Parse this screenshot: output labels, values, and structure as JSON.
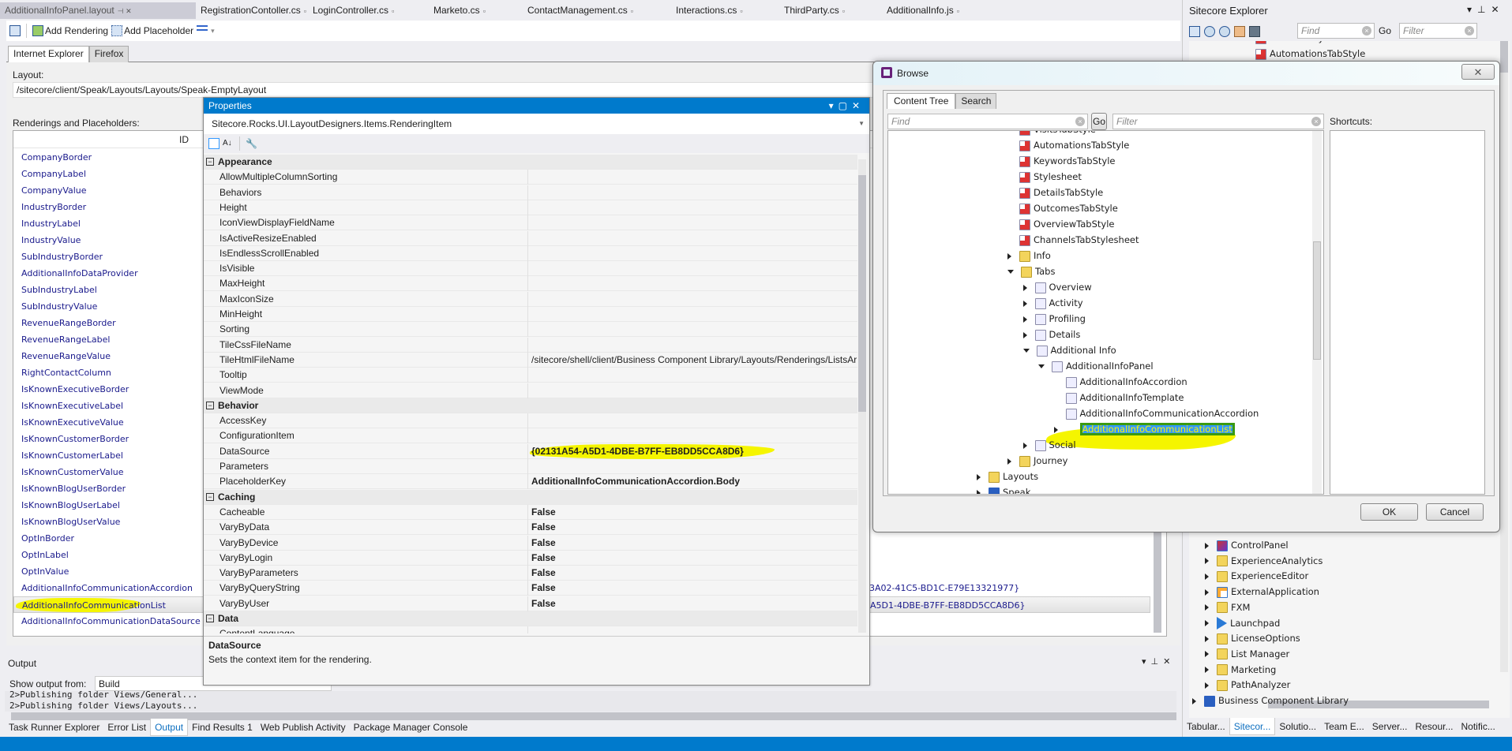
{
  "doc_tabs": [
    "AdditionalInfoPanel.layout",
    "RegistrationContoller.cs",
    "LoginController.cs",
    "Marketo.cs",
    "ContactManagement.cs",
    "Interactions.cs",
    "ThirdParty.cs",
    "AdditionalInfo.js"
  ],
  "toolbar": {
    "add_rendering": "Add Rendering",
    "add_placeholder": "Add Placeholder"
  },
  "browser_tabs": [
    "Internet Explorer",
    "Firefox"
  ],
  "layout": {
    "label": "Layout:",
    "value": "/sitecore/client/Speak/Layouts/Layouts/Speak-EmptyLayout"
  },
  "renderings": {
    "label": "Renderings and Placeholders:",
    "id_header": "ID",
    "items": [
      "CompanyBorder",
      "CompanyLabel",
      "CompanyValue",
      "IndustryBorder",
      "IndustryLabel",
      "IndustryValue",
      "SubIndustryBorder",
      "AdditionalInfoDataProvider",
      "SubIndustryLabel",
      "SubIndustryValue",
      "RevenueRangeBorder",
      "RevenueRangeLabel",
      "RevenueRangeValue",
      "RightContactColumn",
      "IsKnownExecutiveBorder",
      "IsKnownExecutiveLabel",
      "IsKnownExecutiveValue",
      "IsKnownCustomerBorder",
      "IsKnownCustomerLabel",
      "IsKnownCustomerValue",
      "IsKnownBlogUserBorder",
      "IsKnownBlogUserLabel",
      "IsKnownBlogUserValue",
      "OptInBorder",
      "OptInLabel",
      "OptInValue",
      "AdditionalInfoCommunicationAccordion",
      "AdditionalInfoCommunicationList",
      "AdditionalInfoCommunicationDataSource"
    ],
    "selected": "AdditionalInfoCommunicationList",
    "visible_ids": {
      "AdditionalInfoCommunicationAccordion": "3A02-41C5-BD1C-E79E13321977}",
      "AdditionalInfoCommunicationList": "A5D1-4DBE-B7FF-EB8DD5CCA8D6}"
    }
  },
  "properties": {
    "title": "Properties",
    "object": "Sitecore.Rocks.UI.LayoutDesigners.Items.RenderingItem",
    "categories": [
      {
        "name": "Appearance",
        "items": [
          {
            "name": "AllowMultipleColumnSorting",
            "value": ""
          },
          {
            "name": "Behaviors",
            "value": ""
          },
          {
            "name": "Height",
            "value": ""
          },
          {
            "name": "IconViewDisplayFieldName",
            "value": ""
          },
          {
            "name": "IsActiveResizeEnabled",
            "value": ""
          },
          {
            "name": "IsEndlessScrollEnabled",
            "value": ""
          },
          {
            "name": "IsVisible",
            "value": ""
          },
          {
            "name": "MaxHeight",
            "value": ""
          },
          {
            "name": "MaxIconSize",
            "value": ""
          },
          {
            "name": "MinHeight",
            "value": ""
          },
          {
            "name": "Sorting",
            "value": ""
          },
          {
            "name": "TileCssFileName",
            "value": ""
          },
          {
            "name": "TileHtmlFileName",
            "value": "/sitecore/shell/client/Business Component Library/Layouts/Renderings/ListsAr",
            "modified": false
          },
          {
            "name": "Tooltip",
            "value": ""
          },
          {
            "name": "ViewMode",
            "value": ""
          }
        ]
      },
      {
        "name": "Behavior",
        "items": [
          {
            "name": "AccessKey",
            "value": ""
          },
          {
            "name": "ConfigurationItem",
            "value": ""
          },
          {
            "name": "DataSource",
            "value": "{02131A54-A5D1-4DBE-B7FF-EB8DD5CCA8D6}",
            "modified": true,
            "highlight": true
          },
          {
            "name": "Parameters",
            "value": ""
          },
          {
            "name": "PlaceholderKey",
            "value": "AdditionalInfoCommunicationAccordion.Body",
            "modified": true
          }
        ]
      },
      {
        "name": "Caching",
        "items": [
          {
            "name": "Cacheable",
            "value": "False",
            "modified": true
          },
          {
            "name": "VaryByData",
            "value": "False",
            "modified": true
          },
          {
            "name": "VaryByDevice",
            "value": "False",
            "modified": true
          },
          {
            "name": "VaryByLogin",
            "value": "False",
            "modified": true
          },
          {
            "name": "VaryByParameters",
            "value": "False",
            "modified": true
          },
          {
            "name": "VaryByQueryString",
            "value": "False",
            "modified": true
          },
          {
            "name": "VaryByUser",
            "value": "False",
            "modified": true
          }
        ]
      },
      {
        "name": "Data",
        "items": [
          {
            "name": "ContentLanguage",
            "value": ""
          }
        ]
      }
    ],
    "description_title": "DataSource",
    "description_text": "Sets the context item for the rendering."
  },
  "output": {
    "title": "Output",
    "show_from_label": "Show output from:",
    "show_from_value": "Build",
    "lines": [
      "2>Publishing folder Views/General...",
      "2>Publishing folder Views/Layouts..."
    ]
  },
  "bottom_tabs": [
    "Task Runner Explorer",
    "Error List",
    "Output",
    "Find Results 1",
    "Web Publish Activity",
    "Package Manager Console"
  ],
  "bottom_tab_active": "Output",
  "explorer": {
    "title": "Sitecore Explorer",
    "find_placeholder": "Find",
    "go": "Go",
    "filter_placeholder": "Filter",
    "top_items": [
      "VisitsTabStyle",
      "AutomationsTabStyle",
      "KeywordsTabStyle"
    ],
    "items": [
      {
        "label": "ControlPanel",
        "icon": "cp"
      },
      {
        "label": "ExperienceAnalytics",
        "icon": "folder"
      },
      {
        "label": "ExperienceEditor",
        "icon": "folder"
      },
      {
        "label": "ExternalApplication",
        "icon": "app"
      },
      {
        "label": "FXM",
        "icon": "folder"
      },
      {
        "label": "Launchpad",
        "icon": "launch"
      },
      {
        "label": "LicenseOptions",
        "icon": "folder"
      },
      {
        "label": "List Manager",
        "icon": "folder"
      },
      {
        "label": "Marketing",
        "icon": "folder"
      },
      {
        "label": "PathAnalyzer",
        "icon": "folder"
      },
      {
        "label": "Business Component Library",
        "icon": "lib"
      }
    ],
    "tabs": [
      "Tabular...",
      "Sitecor...",
      "Solutio...",
      "Team E...",
      "Server...",
      "Resour...",
      "Notific..."
    ],
    "tab_active": "Sitecor..."
  },
  "browse": {
    "title": "Browse",
    "tabs": [
      "Content Tree",
      "Search"
    ],
    "find_placeholder": "Find",
    "go": "Go",
    "filter_placeholder": "Filter",
    "shortcuts_label": "Shortcuts:",
    "ok": "OK",
    "cancel": "Cancel",
    "tree": [
      {
        "label": "VisitsTabStyle",
        "level": 2,
        "icon": "docx",
        "state": "none"
      },
      {
        "label": "AutomationsTabStyle",
        "level": 2,
        "icon": "docx",
        "state": "none"
      },
      {
        "label": "KeywordsTabStyle",
        "level": 2,
        "icon": "docx",
        "state": "none"
      },
      {
        "label": "Stylesheet",
        "level": 2,
        "icon": "docx",
        "state": "none"
      },
      {
        "label": "DetailsTabStyle",
        "level": 2,
        "icon": "docx",
        "state": "none"
      },
      {
        "label": "OutcomesTabStyle",
        "level": 2,
        "icon": "docx",
        "state": "none"
      },
      {
        "label": "OverviewTabStyle",
        "level": 2,
        "icon": "docx",
        "state": "none"
      },
      {
        "label": "ChannelsTabStylesheet",
        "level": 2,
        "icon": "docx",
        "state": "none"
      },
      {
        "label": "Info",
        "level": 2,
        "icon": "folder",
        "state": "closed"
      },
      {
        "label": "Tabs",
        "level": 2,
        "icon": "folder",
        "state": "open"
      },
      {
        "label": "Overview",
        "level": 3,
        "icon": "doc",
        "state": "closed"
      },
      {
        "label": "Activity",
        "level": 3,
        "icon": "doc",
        "state": "closed"
      },
      {
        "label": "Profiling",
        "level": 3,
        "icon": "doc",
        "state": "closed"
      },
      {
        "label": "Details",
        "level": 3,
        "icon": "doc",
        "state": "closed"
      },
      {
        "label": "Additional Info",
        "level": 3,
        "icon": "doc",
        "state": "open"
      },
      {
        "label": "AdditionalInfoPanel",
        "level": 4,
        "icon": "doc",
        "state": "open"
      },
      {
        "label": "AdditionalInfoAccordion",
        "level": 5,
        "icon": "doc",
        "state": "none"
      },
      {
        "label": "AdditionalInfoTemplate",
        "level": 5,
        "icon": "doc",
        "state": "none"
      },
      {
        "label": "AdditionalInfoCommunicationAccordion",
        "level": 5,
        "icon": "doc",
        "state": "none"
      },
      {
        "label": "AdditionalInfoCommunicationList",
        "level": 5,
        "icon": "list",
        "state": "closed",
        "selected": true
      },
      {
        "label": "Social",
        "level": 3,
        "icon": "doc",
        "state": "closed"
      },
      {
        "label": "Journey",
        "level": 2,
        "icon": "folder",
        "state": "closed"
      },
      {
        "label": "Layouts",
        "level": 0,
        "icon": "folder",
        "state": "closed"
      },
      {
        "label": "Speak",
        "level": 0,
        "icon": "lib",
        "state": "closed"
      }
    ]
  },
  "colors": {
    "accent": "#007acc",
    "highlight": "#f5f500",
    "selection": "#3399ff",
    "link_text": "#1a1a8c"
  }
}
